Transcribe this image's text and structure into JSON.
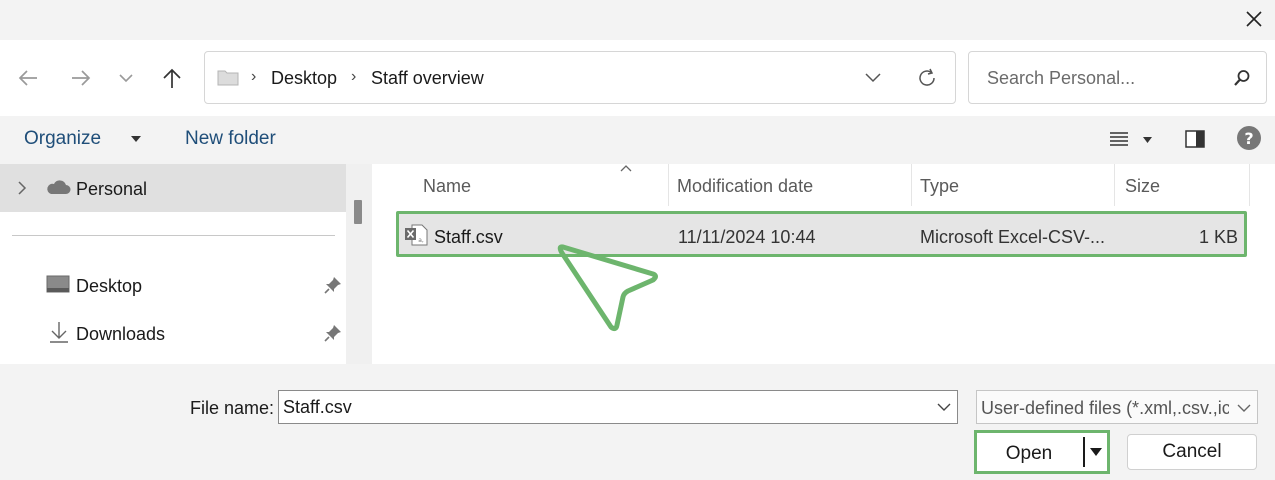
{
  "window": {
    "close_icon": "close-icon"
  },
  "nav": {
    "back_icon": "arrow-left-icon",
    "forward_icon": "arrow-right-icon",
    "recent_icon": "chevron-down-icon",
    "up_icon": "arrow-up-icon"
  },
  "address": {
    "breadcrumbs": [
      "Desktop",
      "Staff overview"
    ],
    "refresh_icon": "refresh-icon"
  },
  "search": {
    "placeholder": "Search Personal..."
  },
  "toolbar": {
    "organize_label": "Organize",
    "new_folder_label": "New folder"
  },
  "sidebar": {
    "items": [
      {
        "label": "Personal",
        "icon": "cloud-icon",
        "selected": true
      },
      {
        "label": "Desktop",
        "icon": "desktop-icon",
        "pinned": true
      },
      {
        "label": "Downloads",
        "icon": "download-icon",
        "pinned": true
      }
    ]
  },
  "file_list": {
    "columns": [
      "Name",
      "Modification date",
      "Type",
      "Size"
    ],
    "rows": [
      {
        "name": "Staff.csv",
        "modified": "11/11/2024 10:44",
        "type": "Microsoft Excel-CSV-...",
        "size": "1 KB",
        "icon": "excel-csv-file-icon"
      }
    ]
  },
  "footer": {
    "filename_label": "File name:",
    "filename_value": "Staff.csv",
    "filetype_value": "User-defined files (*.xml,.csv.,ic",
    "open_label": "Open",
    "cancel_label": "Cancel"
  },
  "colors": {
    "highlight": "#6db56d",
    "selected_row": "#e5e5e5",
    "link": "#1f4e79"
  }
}
